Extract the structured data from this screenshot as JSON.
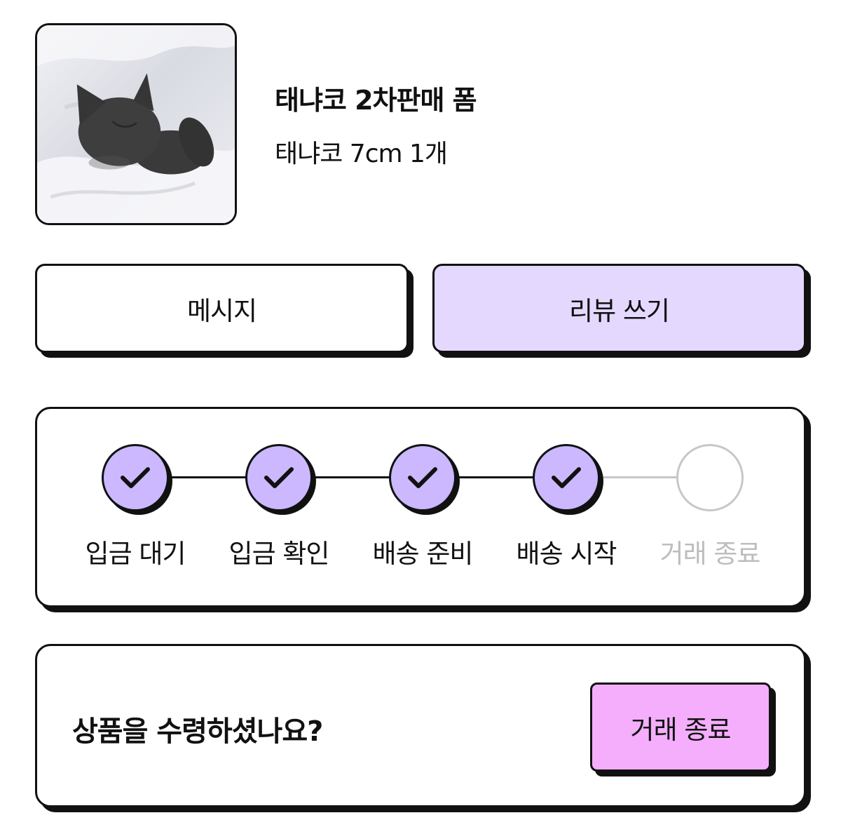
{
  "product": {
    "title": "태냐코 2차판매 폼",
    "option": "태냐코 7cm 1개"
  },
  "actions": {
    "message_label": "메시지",
    "review_label": "리뷰 쓰기"
  },
  "progress": {
    "steps": [
      {
        "label": "입금 대기",
        "done": true
      },
      {
        "label": "입금 확인",
        "done": true
      },
      {
        "label": "배송 준비",
        "done": true
      },
      {
        "label": "배송 시작",
        "done": true
      },
      {
        "label": "거래 종료",
        "done": false
      }
    ]
  },
  "receive": {
    "question": "상품을 수령하셨나요?",
    "complete_label": "거래 종료"
  },
  "colors": {
    "review_button": "#e4d8ff",
    "step_done": "#cbb8ff",
    "complete_button": "#f4aefb",
    "step_pending_text": "#bdbdbd",
    "connector_done": "#111111",
    "connector_pending": "#c7c7c7"
  },
  "icons": {
    "product_image": "black-cat-plush-photo",
    "step_done": "check-icon"
  }
}
